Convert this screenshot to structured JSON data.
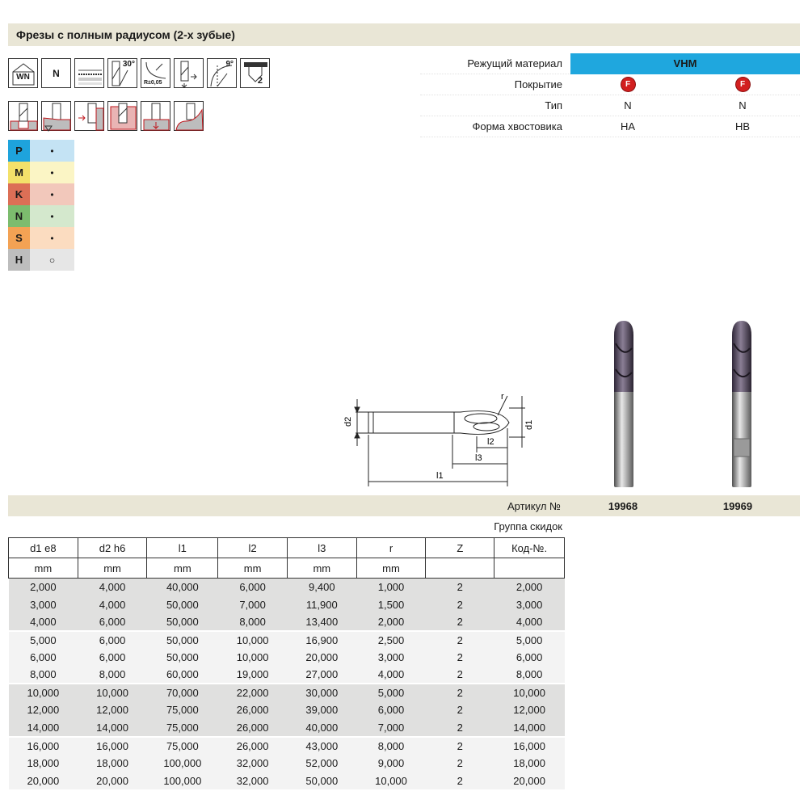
{
  "title": "Фрезы с полным радиусом (2-х зубые)",
  "icons_row1": [
    {
      "name": "wn-norm-icon",
      "text": "WN"
    },
    {
      "name": "type-n-icon",
      "text": "N"
    },
    {
      "name": "coating-layers-icon",
      "text": ""
    },
    {
      "name": "helix-30-icon",
      "text": "30°"
    },
    {
      "name": "radius-tolerance-icon",
      "text": "R±0,05"
    },
    {
      "name": "centre-cutting-icon",
      "text": ""
    },
    {
      "name": "clearance-9-icon",
      "text": "9°"
    },
    {
      "name": "teeth-2-icon",
      "text": "2"
    }
  ],
  "icons_row2": [
    {
      "name": "slot-milling-icon"
    },
    {
      "name": "plunge-profile-icon"
    },
    {
      "name": "side-milling-icon"
    },
    {
      "name": "pocket-milling-icon"
    },
    {
      "name": "drilling-icon"
    },
    {
      "name": "copy-milling-icon"
    }
  ],
  "materials": [
    {
      "letter": "P",
      "value": "•",
      "color": "#1ea3dc",
      "bg": "#c4e3f4"
    },
    {
      "letter": "M",
      "value": "•",
      "color": "#f3e16a",
      "bg": "#fbf5c5"
    },
    {
      "letter": "K",
      "value": "•",
      "color": "#dc6f56",
      "bg": "#f2c8bb"
    },
    {
      "letter": "N",
      "value": "•",
      "color": "#7cbc6e",
      "bg": "#d4e8cd"
    },
    {
      "letter": "S",
      "value": "•",
      "color": "#f3a254",
      "bg": "#fbdcc0"
    },
    {
      "letter": "H",
      "value": "○",
      "color": "#bdbdbd",
      "bg": "#e6e6e6"
    }
  ],
  "properties": {
    "cutting_material": {
      "label": "Режущий материал",
      "value": "VHM"
    },
    "coating": {
      "label": "Покрытие",
      "v1": "F",
      "v2": "F"
    },
    "type": {
      "label": "Тип",
      "v1": "N",
      "v2": "N"
    },
    "shank": {
      "label": "Форма хвостовика",
      "v1": "HA",
      "v2": "HB"
    }
  },
  "drawing_labels": {
    "d2": "d2",
    "d1": "d1",
    "r": "r",
    "l1": "l1",
    "l2": "l2",
    "l3": "l3"
  },
  "article": {
    "label": "Артикул №",
    "code1": "19968",
    "code2": "19969"
  },
  "discount_group": "Группа скидок",
  "table": {
    "headers": [
      "d1 e8",
      "d2 h6",
      "l1",
      "l2",
      "l3",
      "r",
      "Z",
      "Код-№."
    ],
    "units": [
      "mm",
      "mm",
      "mm",
      "mm",
      "mm",
      "mm",
      "",
      ""
    ],
    "rows": [
      [
        "2,000",
        "4,000",
        "40,000",
        "6,000",
        "9,400",
        "1,000",
        "2",
        "2,000"
      ],
      [
        "3,000",
        "4,000",
        "50,000",
        "7,000",
        "11,900",
        "1,500",
        "2",
        "3,000"
      ],
      [
        "4,000",
        "6,000",
        "50,000",
        "8,000",
        "13,400",
        "2,000",
        "2",
        "4,000"
      ],
      [
        "5,000",
        "6,000",
        "50,000",
        "10,000",
        "16,900",
        "2,500",
        "2",
        "5,000"
      ],
      [
        "6,000",
        "6,000",
        "50,000",
        "10,000",
        "20,000",
        "3,000",
        "2",
        "6,000"
      ],
      [
        "8,000",
        "8,000",
        "60,000",
        "19,000",
        "27,000",
        "4,000",
        "2",
        "8,000"
      ],
      [
        "10,000",
        "10,000",
        "70,000",
        "22,000",
        "30,000",
        "5,000",
        "2",
        "10,000"
      ],
      [
        "12,000",
        "12,000",
        "75,000",
        "26,000",
        "39,000",
        "6,000",
        "2",
        "12,000"
      ],
      [
        "14,000",
        "14,000",
        "75,000",
        "26,000",
        "40,000",
        "7,000",
        "2",
        "14,000"
      ],
      [
        "16,000",
        "16,000",
        "75,000",
        "26,000",
        "43,000",
        "8,000",
        "2",
        "16,000"
      ],
      [
        "18,000",
        "18,000",
        "100,000",
        "32,000",
        "52,000",
        "9,000",
        "2",
        "18,000"
      ],
      [
        "20,000",
        "20,000",
        "100,000",
        "32,000",
        "50,000",
        "10,000",
        "2",
        "20,000"
      ]
    ]
  }
}
